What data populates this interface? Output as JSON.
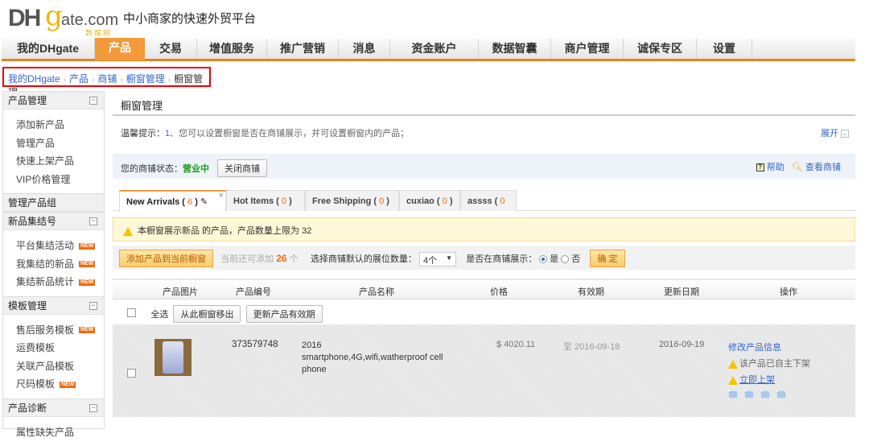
{
  "header": {
    "logo_text": "DHgate.com",
    "logo_cn": "敦煌网",
    "slogan": "中小商家的快速外贸平台"
  },
  "nav": [
    "我的DHgate",
    "产品",
    "交易",
    "增值服务",
    "推广营销",
    "消息",
    "资金账户",
    "数据智囊",
    "商户管理",
    "诚保专区",
    "设置"
  ],
  "breadcrumb": [
    "我的DHgate",
    "产品",
    "商铺",
    "橱窗管理",
    "橱窗管理"
  ],
  "sidebar": {
    "g1": {
      "title": "产品管理",
      "items": [
        "添加新产品",
        "管理产品",
        "快速上架产品",
        "VIP价格管理"
      ]
    },
    "g2": {
      "title": "管理产品组"
    },
    "g3": {
      "title": "新品集结号",
      "items": [
        "平台集结活动",
        "我集结的新品",
        "集结新品统计"
      ]
    },
    "g4": {
      "title": "模板管理",
      "items": [
        "售后服务模板",
        "运费模板",
        "关联产品模板",
        "尺码模板"
      ]
    },
    "g5": {
      "title": "产品诊断",
      "items": [
        "属性缺失产品"
      ]
    },
    "new_badge": "NEW"
  },
  "main": {
    "title": "橱窗管理",
    "tip_label": "温馨提示：",
    "tip_num": "1",
    "tip_text": "、您可以设置橱窗是否在商铺展示，并可设置橱窗内的产品；",
    "expand": "展开",
    "status_label": "您的商铺状态：",
    "status_value": "营业中",
    "close_store": "关闭商铺",
    "help": "帮助",
    "view_store": "查看商铺",
    "tabs": [
      {
        "name": "New Arrivals",
        "count": "6"
      },
      {
        "name": "Hot Items",
        "count": "0"
      },
      {
        "name": "Free Shipping",
        "count": "0"
      },
      {
        "name": "cuxiao",
        "count": "0"
      },
      {
        "name": "assss",
        "count": "0"
      }
    ],
    "warning": "本橱窗展示新品 的产品，产品数量上限为 32",
    "add_btn": "添加产品到当前橱窗",
    "remain_prefix": "当前还可添加",
    "remain_count": "26",
    "remain_suffix": "个",
    "slots_label": "选择商铺默认的展位数量：",
    "slots_value": "4个",
    "show_label": "是否在商铺展示：",
    "yes": "是",
    "no": "否",
    "confirm": "确 定",
    "columns": [
      "产品图片",
      "产品编号",
      "产品名称",
      "价格",
      "有效期",
      "更新日期",
      "操作"
    ],
    "select_all": "全选",
    "remove_btn": "从此橱窗移出",
    "renew_btn": "更新产品有效期",
    "product": {
      "id": "373579748",
      "name_line1": "2016",
      "name_line2": "smartphone,4G,wifi,watherproof cell",
      "name_line3": "phone",
      "price": "$ 4020.11",
      "valid": "至 2016-09-18",
      "updated": "2016-09-19",
      "edit": "修改产品信息",
      "off_shelf": "该产品已自主下架",
      "relist": "立即上架"
    }
  }
}
